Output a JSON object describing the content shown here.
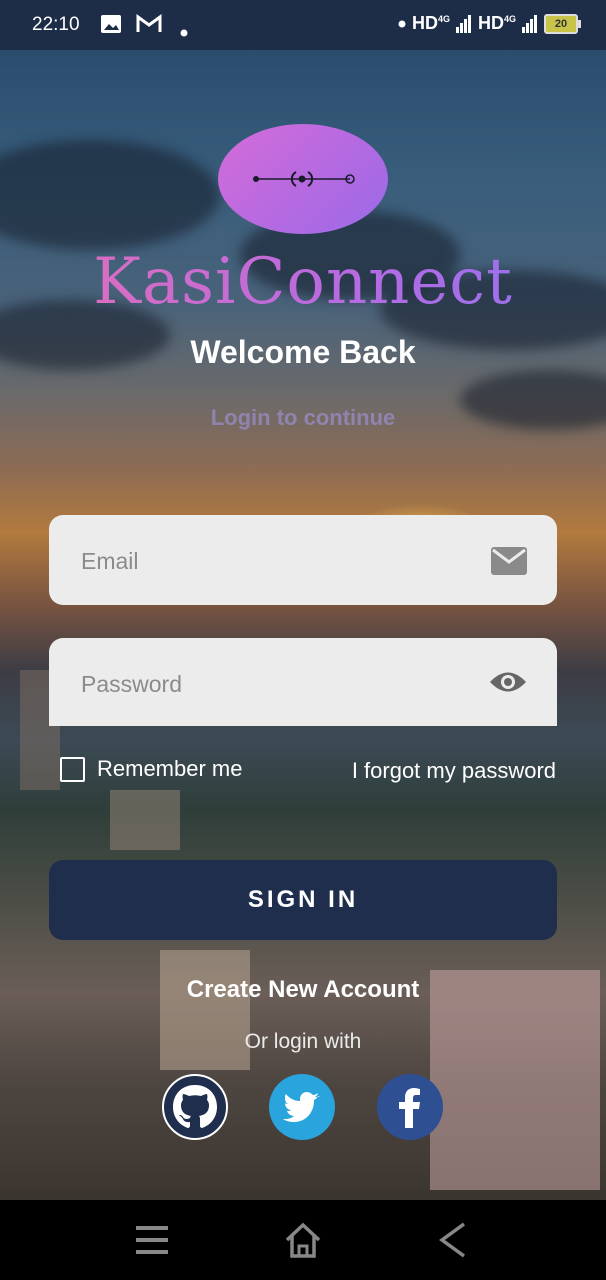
{
  "status_bar": {
    "time": "22:10",
    "icons": [
      "image-icon",
      "gmail-icon",
      "dot-icon"
    ],
    "network_1": "HD",
    "network_2": "HD",
    "net_type_1": "4G",
    "net_type_2": "4G",
    "battery": "20"
  },
  "logo": {
    "title": "KasiConnect",
    "colors": [
      "#e46fb6",
      "#8f72f0"
    ]
  },
  "welcome": {
    "title": "Welcome Back",
    "subtitle": "Login to continue"
  },
  "form": {
    "email_placeholder": "Email",
    "password_placeholder": "Password",
    "remember_label": "Remember me",
    "forgot_label": "I forgot my password",
    "signin_label": "SIGN IN"
  },
  "links": {
    "create_account": "Create New Account",
    "or_login_with": "Or login with"
  },
  "social": [
    "github-icon",
    "twitter-icon",
    "facebook-icon"
  ],
  "nav": [
    "menu-icon",
    "home-icon",
    "back-icon"
  ],
  "colors": {
    "accent": "#1e2e4c",
    "field_bg": "#ececec",
    "twitter": "#2aa4dd",
    "facebook": "#2f4f93"
  }
}
